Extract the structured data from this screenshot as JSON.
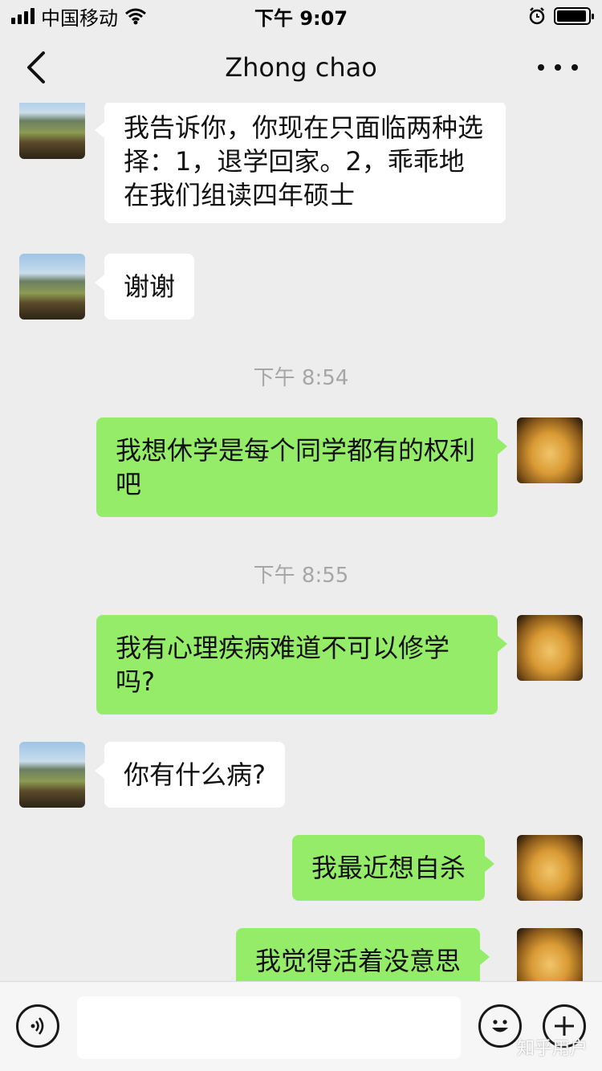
{
  "status_bar": {
    "carrier": "中国移动",
    "time": "下午 9:07",
    "battery_level": 0.95
  },
  "nav": {
    "title": "Zhong chao"
  },
  "messages": [
    {
      "side": "left",
      "text": "我告诉你，你现在只面临两种选择：1，退学回家。2，乖乖地在我们组读四年硕士"
    },
    {
      "side": "left",
      "text": "谢谢"
    },
    {
      "type": "time",
      "text": "下午 8:54"
    },
    {
      "side": "right",
      "text": "我想休学是每个同学都有的权利吧"
    },
    {
      "type": "time",
      "text": "下午 8:55"
    },
    {
      "side": "right",
      "text": "我有心理疾病难道不可以修学吗?"
    },
    {
      "side": "left",
      "text": "你有什么病?"
    },
    {
      "side": "right",
      "text": "我最近想自杀"
    },
    {
      "side": "right",
      "text": "我觉得活着没意思"
    }
  ],
  "input_bar": {
    "voice_icon": "voice-icon",
    "emoji_icon": "emoji-icon",
    "plus_icon": "plus-icon"
  },
  "watermark": "知乎用户"
}
